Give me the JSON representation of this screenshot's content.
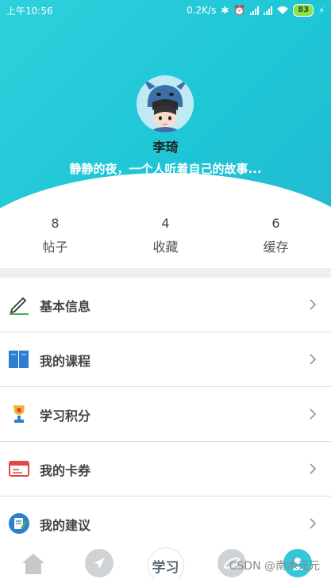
{
  "status_bar": {
    "time": "上午10:56",
    "speed": "0.2K/s",
    "battery": "83"
  },
  "profile": {
    "name": "李琦",
    "signature": "静静的夜，一个人听着自己的故事..."
  },
  "stats": [
    {
      "value": "8",
      "label": "帖子"
    },
    {
      "value": "4",
      "label": "收藏"
    },
    {
      "value": "6",
      "label": "缓存"
    }
  ],
  "menu": [
    {
      "label": "基本信息",
      "icon": "pencil-icon"
    },
    {
      "label": "我的课程",
      "icon": "book-icon"
    },
    {
      "label": "学习积分",
      "icon": "trophy-icon"
    },
    {
      "label": "我的卡券",
      "icon": "card-icon"
    },
    {
      "label": "我的建议",
      "icon": "feedback-icon"
    }
  ],
  "tabbar": {
    "center_label": "学习",
    "tabs": [
      "home-icon",
      "navigate-icon",
      "study",
      "planet-icon",
      "profile-icon"
    ]
  },
  "watermark": "CSDN @南木元元",
  "colors": {
    "header": "#2fd0dc",
    "accent": "#35c6d9"
  }
}
